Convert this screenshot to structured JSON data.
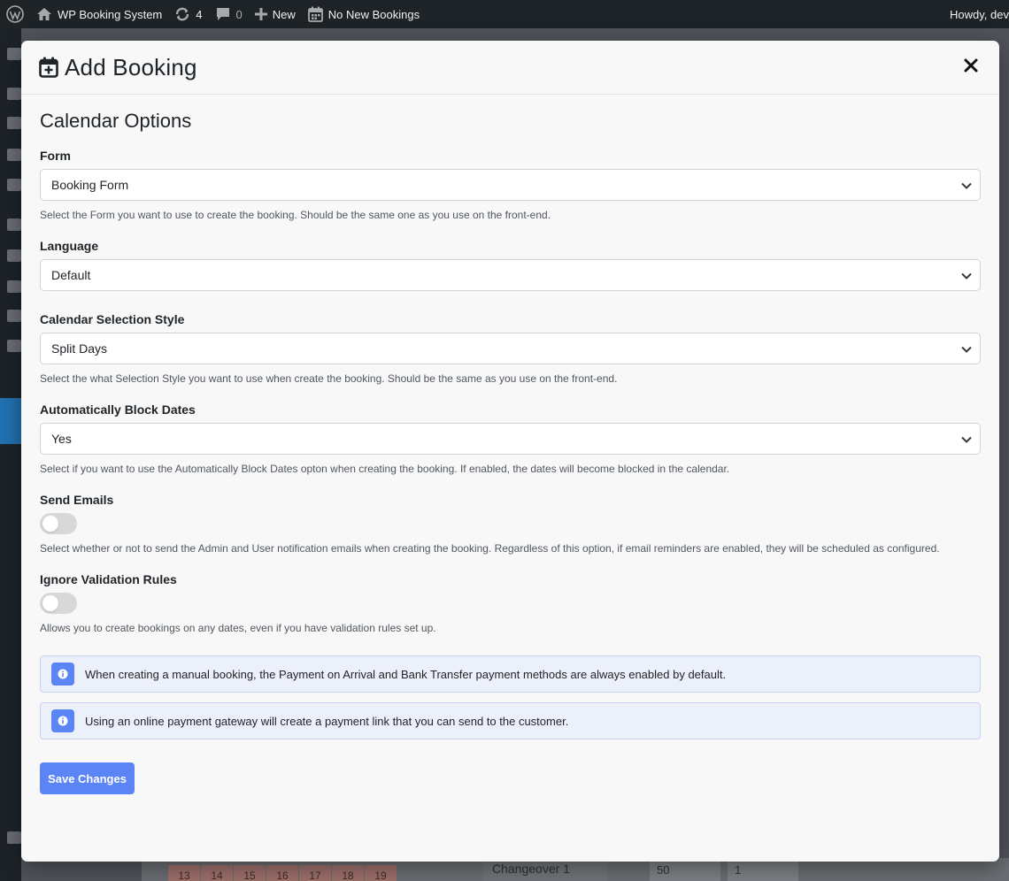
{
  "adminbar": {
    "site_name": "WP Booking System",
    "updates_count": "4",
    "comments_count": "0",
    "new_label": "New",
    "bookings_label": "No New Bookings",
    "howdy": "Howdy, dev"
  },
  "modal": {
    "title": "Add Booking",
    "section_title": "Calendar Options",
    "fields": [
      {
        "label": "Form",
        "value": "Booking Form",
        "help": "Select the Form you want to use to create the booking. Should be the same one as you use on the front-end."
      },
      {
        "label": "Language",
        "value": "Default",
        "help": ""
      },
      {
        "label": "Calendar Selection Style",
        "value": "Split Days",
        "help": "Select the what Selection Style you want to use when create the booking. Should be the same as you use on the front-end."
      },
      {
        "label": "Automatically Block Dates",
        "value": "Yes",
        "help": "Select if you want to use the Automatically Block Dates opton when creating the booking. If enabled, the dates will become blocked in the calendar."
      }
    ],
    "toggles": [
      {
        "label": "Send Emails",
        "enabled": false,
        "help": "Select whether or not to send the Admin and User notification emails when creating the booking. Regardless of this option, if email reminders are enabled, they will be scheduled as configured."
      },
      {
        "label": "Ignore Validation Rules",
        "enabled": false,
        "help": "Allows you to create bookings on any dates, even if you have validation rules set up."
      }
    ],
    "notices": [
      "When creating a manual booking, the Payment on Arrival and Bank Transfer payment methods are always enabled by default.",
      "Using an online payment gateway will create a payment link that you can send to the customer."
    ],
    "save_label": "Save Changes"
  },
  "background": {
    "calendar_days": [
      "13",
      "14",
      "15",
      "16",
      "17",
      "18",
      "19"
    ],
    "changeover_label": "Changeover 1",
    "tags": [
      "50",
      "1"
    ]
  },
  "colors": {
    "accent": "#5b84f5",
    "adminbar": "#1d2327"
  }
}
